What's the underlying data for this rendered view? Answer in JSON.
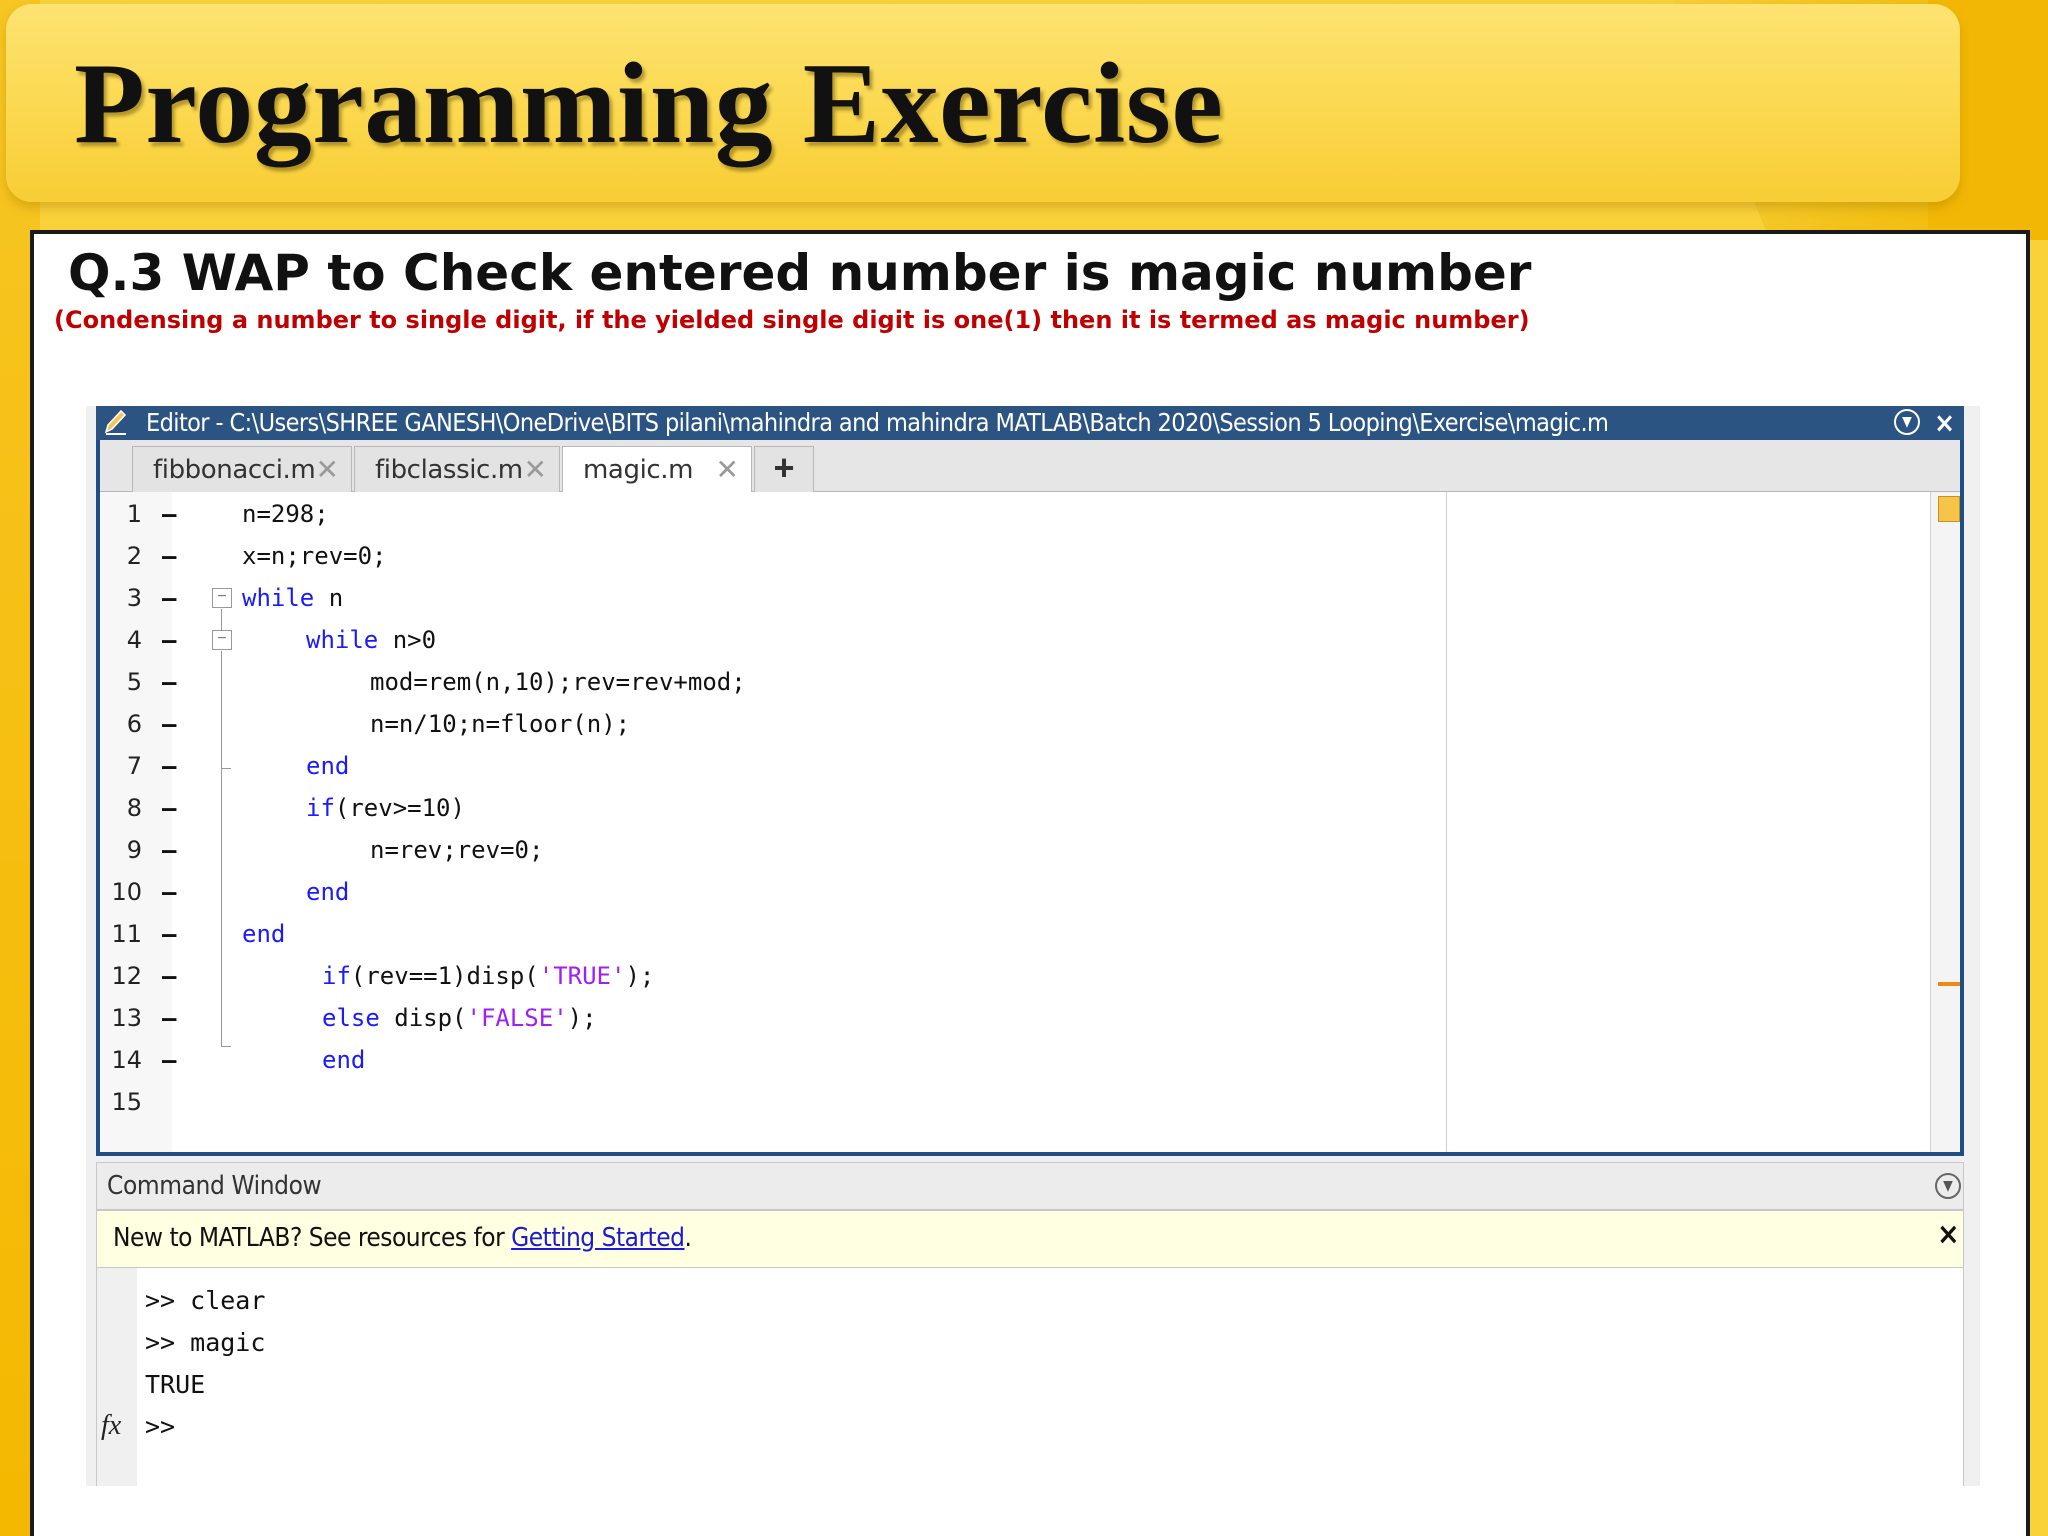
{
  "slide": {
    "title": "Programming Exercise",
    "question": "Q.3 WAP to Check entered number is magic number",
    "note": "(Condensing a number to single digit, if the yielded single digit is one(1) then it is termed as magic number)"
  },
  "editor": {
    "title": "Editor - C:\\Users\\SHREE GANESH\\OneDrive\\BITS pilani\\mahindra and mahindra MATLAB\\Batch 2020\\Session 5 Looping\\Exercise\\magic.m",
    "tabs": [
      {
        "label": "fibbonacci.m",
        "active": false
      },
      {
        "label": "fibclassic.m",
        "active": false
      },
      {
        "label": "magic.m",
        "active": true
      }
    ],
    "add_tab_label": "+",
    "close_label": "×",
    "lines": [
      {
        "num": "1",
        "dash": "–",
        "code": "n=298;"
      },
      {
        "num": "2",
        "dash": "–",
        "code": "x=n;rev=0;"
      },
      {
        "num": "3",
        "dash": "–",
        "kw": "while",
        "code": " n"
      },
      {
        "num": "4",
        "dash": "–",
        "kw": "while",
        "code": " n>0"
      },
      {
        "num": "5",
        "dash": "–",
        "code": "mod=rem(n,10);rev=rev+mod;"
      },
      {
        "num": "6",
        "dash": "–",
        "code": "n=n/10;n=floor(n);"
      },
      {
        "num": "7",
        "dash": "–",
        "kw": "end",
        "code": ""
      },
      {
        "num": "8",
        "dash": "–",
        "kw": "if",
        "code": "(rev>=10)"
      },
      {
        "num": "9",
        "dash": "–",
        "code": "n=rev;rev=0;"
      },
      {
        "num": "10",
        "dash": "–",
        "kw": "end",
        "code": ""
      },
      {
        "num": "11",
        "dash": "–",
        "kw": "end",
        "code": ""
      },
      {
        "num": "12",
        "dash": "–",
        "kw": "if",
        "code": "(rev==1)disp(",
        "str": "'TRUE'",
        "tail": ");"
      },
      {
        "num": "13",
        "dash": "–",
        "kw": "else",
        "code": " disp(",
        "str": "'FALSE'",
        "tail": ");"
      },
      {
        "num": "14",
        "dash": "–",
        "kw": "end",
        "code": ""
      },
      {
        "num": "15",
        "dash": "",
        "code": ""
      }
    ]
  },
  "command_window": {
    "header": "Command Window",
    "notice_prefix": "New to MATLAB? See resources for ",
    "notice_link": "Getting Started",
    "notice_suffix": ".",
    "notice_close": "×",
    "lines": [
      ">> clear",
      ">> magic",
      "TRUE",
      ">>"
    ],
    "fx_label": "fx"
  }
}
